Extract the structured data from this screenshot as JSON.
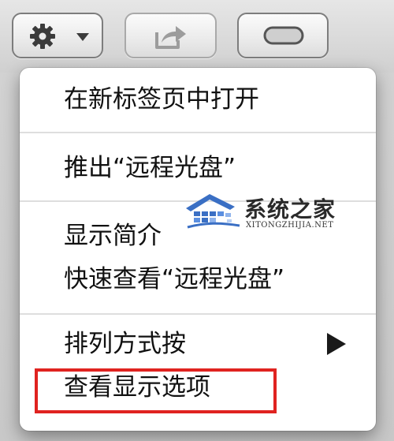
{
  "toolbar": {
    "buttons": [
      {
        "icon": "gear-with-dropdown-icon",
        "enabled": true
      },
      {
        "icon": "share-arrow-icon",
        "enabled": false
      },
      {
        "icon": "toggle-pill-icon",
        "enabled": true
      }
    ]
  },
  "context_menu": {
    "items": {
      "open_new_tab": "在新标签页中打开",
      "eject": "推出“远程光盘”",
      "get_info": "显示简介",
      "quick_look": "快速查看“远程光盘”",
      "arrange_by": "排列方式按",
      "show_view_options": "查看显示选项"
    },
    "highlighted_item": "show_view_options"
  },
  "watermark": {
    "title": "系统之家",
    "subtitle": "XITONGZHIJIA.NET"
  },
  "colors": {
    "highlight": "#e02320",
    "separator": "#dedede"
  }
}
